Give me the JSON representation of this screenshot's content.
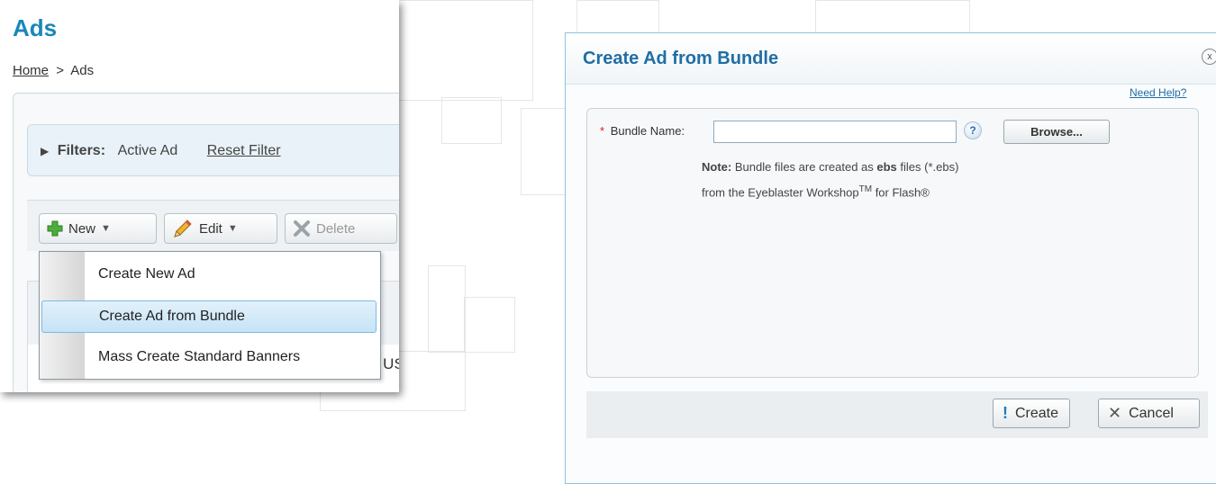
{
  "app": {
    "title": "Ads",
    "breadcrumb": {
      "home": "Home",
      "separator": ">",
      "current": "Ads"
    }
  },
  "filters": {
    "label": "Filters:",
    "active": "Active Ad",
    "reset": "Reset Filter"
  },
  "toolbar": {
    "new_label": "New",
    "edit_label": "Edit",
    "delete_label": "Delete"
  },
  "new_menu": {
    "items": [
      {
        "label": "Create New Ad"
      },
      {
        "label": "Create Ad from Bundle",
        "highlighted": true
      },
      {
        "label": "Mass Create Standard Banners"
      }
    ]
  },
  "table": {
    "partial_text": "_ USE"
  },
  "dialog": {
    "title": "Create Ad from Bundle",
    "close_glyph": "x",
    "need_help": "Need Help?",
    "field_label": "Bundle Name:",
    "required_mark": "*",
    "bundle_value": "",
    "help_glyph": "?",
    "browse_label": "Browse...",
    "note": {
      "bold_prefix": "Note:",
      "line1_a": "Bundle files are created as ",
      "line1_bold": "ebs",
      "line1_b": " files (*.ebs)",
      "line2_a": "from the Eyeblaster Workshop",
      "line2_sup": "TM",
      "line2_b": " for Flash®"
    },
    "create_label": "Create",
    "cancel_label": "Cancel"
  },
  "colors": {
    "accent": "#1a87b8",
    "dialog_title": "#1f6ea5",
    "required": "#dd2222",
    "menu_highlight": "#c6e3f6"
  },
  "icons": {
    "new": "green-plus-icon",
    "edit": "pencil-icon",
    "delete": "gray-x-icon",
    "dropdown": "caret-down-icon",
    "filters": "triangle-right-icon",
    "help": "question-icon",
    "create": "exclamation-icon",
    "cancel": "x-icon",
    "close": "close-icon"
  }
}
